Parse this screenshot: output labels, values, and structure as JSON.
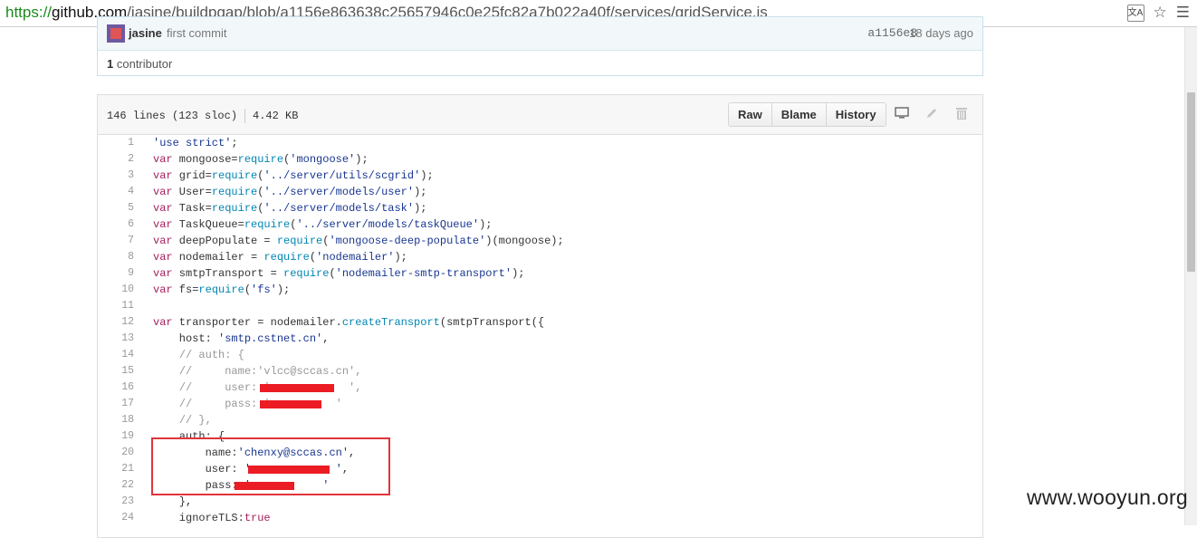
{
  "browser": {
    "url_scheme": "https://",
    "url_host": "github.com",
    "url_path": "/jasine/buildpgap/blob/a1156e863638c25657946c0e25fc82a7b022a40f/services/gridService.js",
    "icons": [
      "translate-icon",
      "star-icon",
      "menu-icon"
    ]
  },
  "commit": {
    "author": "jasine",
    "message": "first commit",
    "sha": "a1156e8",
    "age": "18 days ago",
    "contributors_count": "1",
    "contributors_label": "contributor"
  },
  "file": {
    "lines_info": "146 lines (123 sloc)",
    "size": "4.42 KB",
    "buttons": {
      "raw": "Raw",
      "blame": "Blame",
      "history": "History"
    },
    "icons": [
      "desktop-icon",
      "pencil-icon",
      "trash-icon"
    ]
  },
  "code_lines": [
    {
      "n": "1",
      "text": "'use strict';"
    },
    {
      "n": "2",
      "text": "var mongoose=require('mongoose');"
    },
    {
      "n": "3",
      "text": "var grid=require('../server/utils/scgrid');"
    },
    {
      "n": "4",
      "text": "var User=require('../server/models/user');"
    },
    {
      "n": "5",
      "text": "var Task=require('../server/models/task');"
    },
    {
      "n": "6",
      "text": "var TaskQueue=require('../server/models/taskQueue');"
    },
    {
      "n": "7",
      "text": "var deepPopulate = require('mongoose-deep-populate')(mongoose);"
    },
    {
      "n": "8",
      "text": "var nodemailer = require('nodemailer');"
    },
    {
      "n": "9",
      "text": "var smtpTransport = require('nodemailer-smtp-transport');"
    },
    {
      "n": "10",
      "text": "var fs=require('fs');"
    },
    {
      "n": "11",
      "text": ""
    },
    {
      "n": "12",
      "text": "var transporter = nodemailer.createTransport(smtpTransport({"
    },
    {
      "n": "13",
      "text": "    host: 'smtp.cstnet.cn',"
    },
    {
      "n": "14",
      "text": "    // auth: {"
    },
    {
      "n": "15",
      "text": "    //     name:'vlcc@sccas.cn',"
    },
    {
      "n": "16",
      "text": "    //     user: '            ',"
    },
    {
      "n": "17",
      "text": "    //     pass: '          '"
    },
    {
      "n": "18",
      "text": "    // },"
    },
    {
      "n": "19",
      "text": "    auth: {"
    },
    {
      "n": "20",
      "text": "        name:'chenxy@sccas.cn',"
    },
    {
      "n": "21",
      "text": "        user: '             ',"
    },
    {
      "n": "22",
      "text": "        pass: '           '"
    },
    {
      "n": "23",
      "text": "    },"
    },
    {
      "n": "24",
      "text": "    ignoreTLS:true"
    }
  ],
  "watermark": "www.wooyun.org",
  "colors": {
    "keyword": "#a71d5d",
    "string": "#183691",
    "comment": "#969896",
    "redaction": "#ec1c24",
    "highlight_box": "#e0343a"
  }
}
